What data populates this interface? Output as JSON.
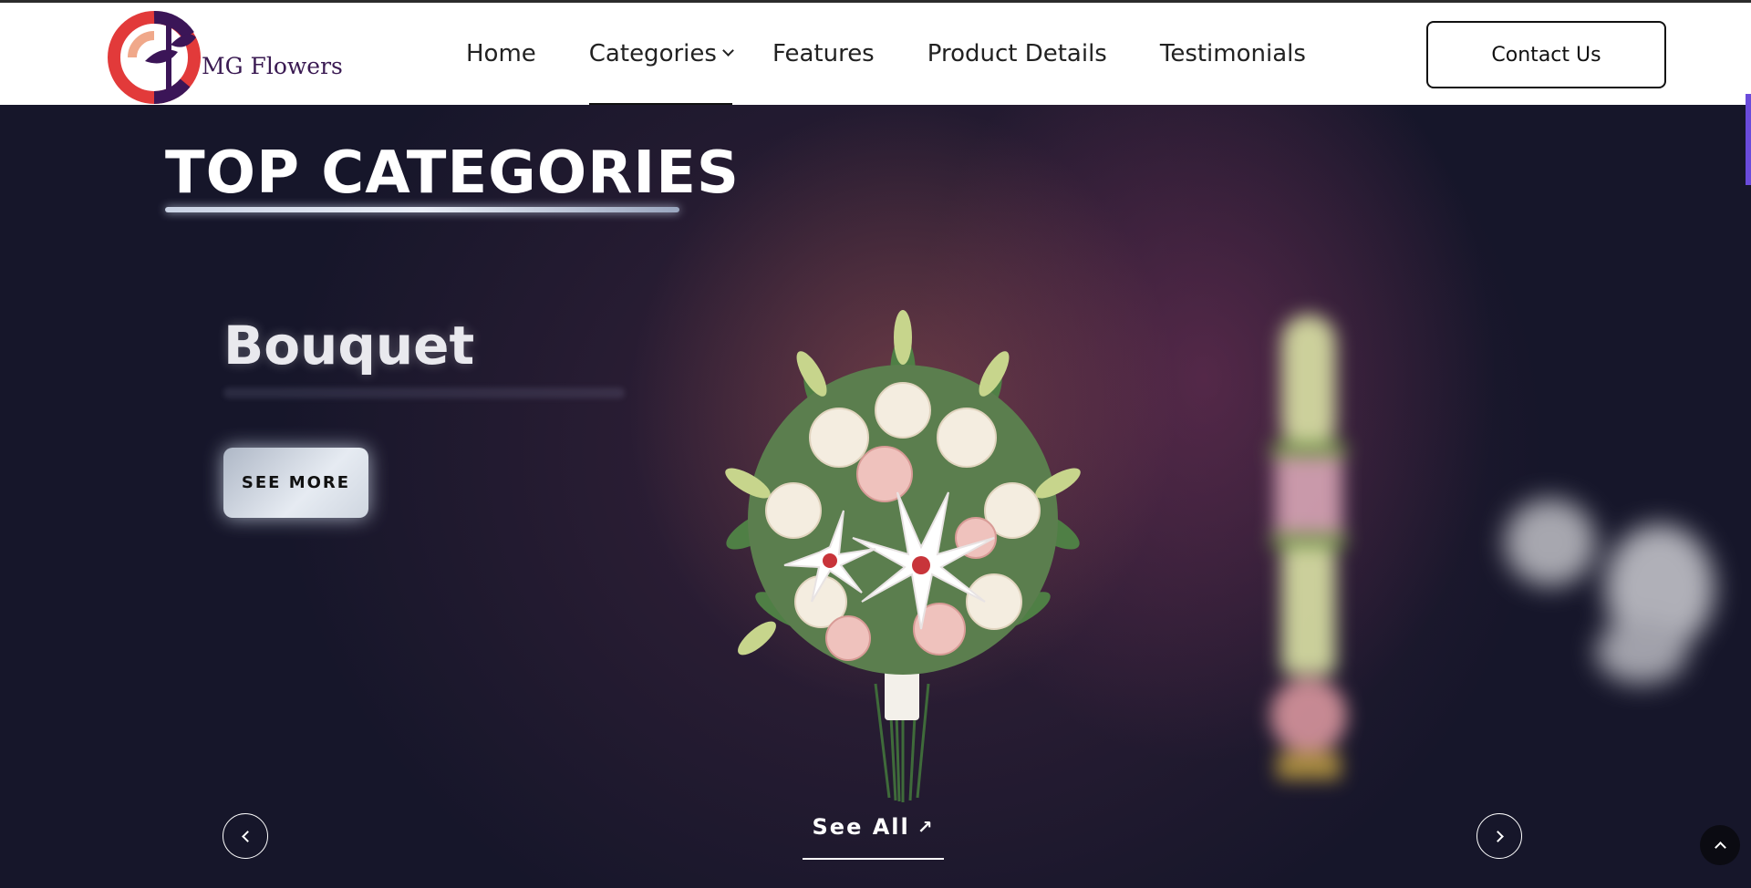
{
  "brand": {
    "name": "MG Flowers"
  },
  "nav": {
    "items": [
      {
        "label": "Home"
      },
      {
        "label": "Categories"
      },
      {
        "label": "Features"
      },
      {
        "label": "Product Details"
      },
      {
        "label": "Testimonials"
      }
    ],
    "active": "Categories",
    "contact_label": "Contact Us"
  },
  "hero": {
    "section_title": "TOP CATEGORIES",
    "category_name": "Bouquet",
    "see_more_label": "SEE MORE",
    "see_all_label": "See All",
    "see_all_icon": "↗"
  },
  "colors": {
    "hero_bg": "#16162a",
    "accent": "#6a4bdb",
    "brand_text": "#3a1a52"
  }
}
